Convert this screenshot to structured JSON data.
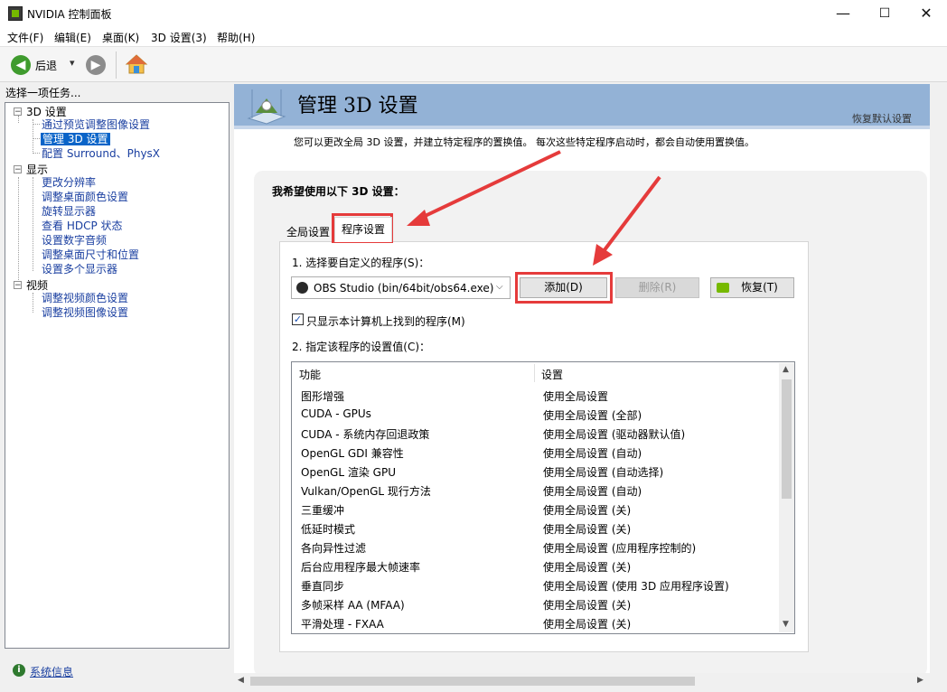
{
  "window": {
    "title": "NVIDIA 控制面板",
    "minimize": "—",
    "maximize": "☐",
    "close": "✕"
  },
  "menu": [
    "文件(F)",
    "编辑(E)",
    "桌面(K)",
    "3D 设置(3)",
    "帮助(H)"
  ],
  "toolbar": {
    "back_label": "后退",
    "dropdown": "▾"
  },
  "left_panel": {
    "task_label": "选择一项任务...",
    "groups": [
      {
        "label": "3D 设置",
        "items": [
          "通过预览调整图像设置",
          "管理 3D 设置",
          "配置 Surround、PhysX"
        ]
      },
      {
        "label": "显示",
        "items": [
          "更改分辨率",
          "调整桌面颜色设置",
          "旋转显示器",
          "查看 HDCP 状态",
          "设置数字音频",
          "调整桌面尺寸和位置",
          "设置多个显示器"
        ]
      },
      {
        "label": "视频",
        "items": [
          "调整视频颜色设置",
          "调整视频图像设置"
        ]
      }
    ],
    "selected_item": "管理 3D 设置",
    "system_info": "系统信息"
  },
  "header": {
    "title": "管理 3D 设置",
    "restore_default": "恢复默认设置",
    "description": "您可以更改全局 3D 设置，并建立特定程序的置换值。 每次这些特定程序启动时，都会自动使用置换值。"
  },
  "settings": {
    "want_label": "我希望使用以下 3D 设置：",
    "tabs": [
      {
        "label": "全局设置",
        "active": false
      },
      {
        "label": "程序设置",
        "active": true
      }
    ],
    "step1_label": "1. 选择要自定义的程序(S)：",
    "program_selected": "OBS Studio (bin/64bit/obs64.exe)",
    "add_button": "添加(D)",
    "remove_button": "删除(R)",
    "restore_button": "恢复(T)",
    "checkbox_label": "只显示本计算机上找到的程序(M)",
    "checkbox_checked": true,
    "step2_label": "2. 指定该程序的设置值(C)：",
    "columns": [
      "功能",
      "设置"
    ],
    "rows": [
      [
        "图形增强",
        "使用全局设置"
      ],
      [
        "CUDA - GPUs",
        "使用全局设置 (全部)"
      ],
      [
        "CUDA - 系统内存回退政策",
        "使用全局设置 (驱动器默认值)"
      ],
      [
        "OpenGL GDI 兼容性",
        "使用全局设置 (自动)"
      ],
      [
        "OpenGL 渲染 GPU",
        "使用全局设置 (自动选择)"
      ],
      [
        "Vulkan/OpenGL 现行方法",
        "使用全局设置 (自动)"
      ],
      [
        "三重缓冲",
        "使用全局设置 (关)"
      ],
      [
        "低延时模式",
        "使用全局设置 (关)"
      ],
      [
        "各向异性过滤",
        "使用全局设置 (应用程序控制的)"
      ],
      [
        "后台应用程序最大帧速率",
        "使用全局设置 (关)"
      ],
      [
        "垂直同步",
        "使用全局设置 (使用 3D 应用程序设置)"
      ],
      [
        "多帧采样 AA (MFAA)",
        "使用全局设置 (关)"
      ],
      [
        "平滑处理 - FXAA",
        "使用全局设置 (关)"
      ]
    ]
  },
  "colors": {
    "highlight_red": "#e53b3b",
    "header_blue": "#93b2d6",
    "selection_blue": "#0a64c8",
    "nvidia_green": "#76b900"
  }
}
